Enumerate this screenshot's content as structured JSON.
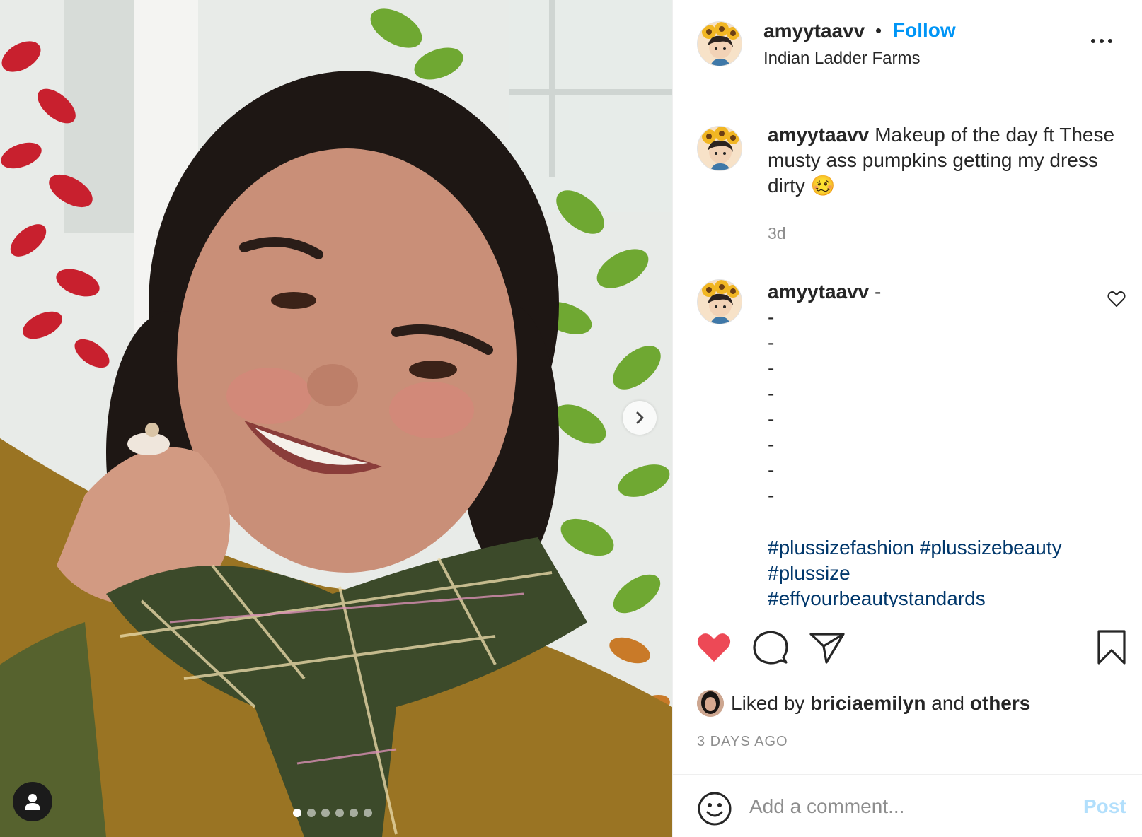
{
  "post": {
    "username": "amyytaavv",
    "separator": "•",
    "follow_label": "Follow",
    "location": "Indian Ladder Farms",
    "more_icon": "more-horizontal-icon"
  },
  "caption": {
    "username": "amyytaavv",
    "text": "Makeup of the day ft These musty ass pumpkins getting my dress dirty",
    "emoji": "🥴",
    "time": "3d"
  },
  "comment": {
    "username": "amyytaavv",
    "first_line": "-",
    "dashes": [
      "-",
      "-",
      "-",
      "-",
      "-",
      "-",
      "-",
      "-"
    ],
    "hashtags": [
      "#plussizefashion",
      "#plussizebeauty",
      "#plussize",
      "#effyourbeautystandards"
    ]
  },
  "actions": {
    "like_icon": "heart-filled-icon",
    "comment_icon": "comment-icon",
    "share_icon": "share-icon",
    "save_icon": "bookmark-icon"
  },
  "likes": {
    "prefix": "Liked by",
    "user": "briciaemilyn",
    "conjunction": "and",
    "others": "others"
  },
  "timestamp": "3 DAYS AGO",
  "add_comment": {
    "placeholder": "Add a comment...",
    "post_label": "Post"
  },
  "carousel": {
    "total": 6,
    "active_index": 0
  },
  "colors": {
    "like_red": "#ed4956",
    "link_blue": "#0095f6",
    "hashtag_blue": "#00376b",
    "muted": "#8e8e8e"
  }
}
